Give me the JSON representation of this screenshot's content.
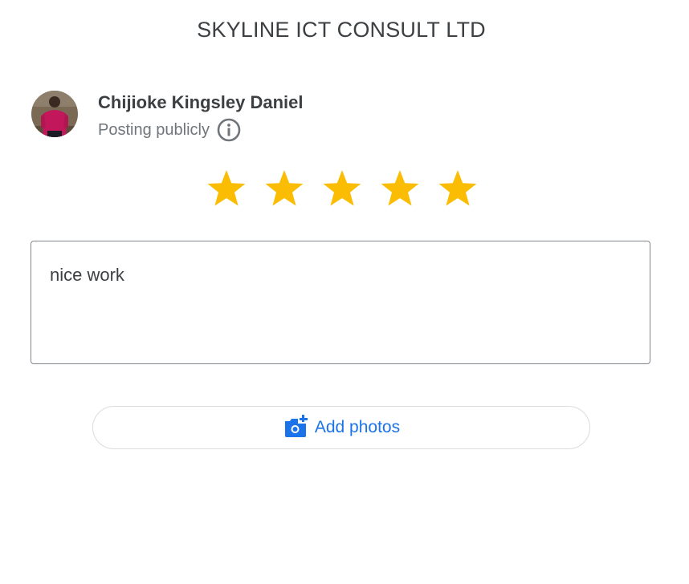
{
  "header": {
    "title": "SKYLINE ICT CONSULT LTD"
  },
  "user": {
    "name": "Chijioke Kingsley Daniel",
    "posting_status": "Posting publicly",
    "avatar_icon": "user-avatar-photo",
    "info_icon": "info-icon"
  },
  "rating": {
    "value": 5,
    "max": 5,
    "star_color": "#fbbc04"
  },
  "review": {
    "text": "nice work"
  },
  "add_photos": {
    "label": "Add photos",
    "icon": "add-photo-camera-icon",
    "color": "#1a73e8"
  }
}
